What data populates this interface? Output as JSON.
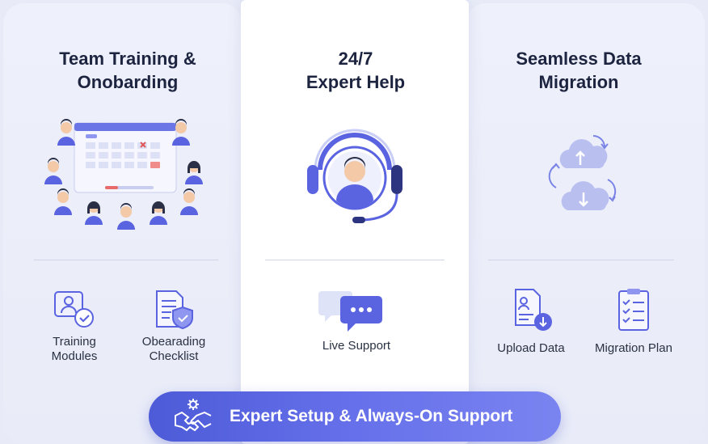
{
  "left": {
    "title_line1": "Team Training &",
    "title_line2": "Onobarding",
    "item1_line1": "Training",
    "item1_line2": "Modules",
    "item2_line1": "Obearading",
    "item2_line2": "Checklist",
    "icons": [
      "team-calendar-icon",
      "training-modules-icon",
      "onboarding-checklist-icon"
    ]
  },
  "center": {
    "title_line1": "24/7",
    "title_line2": "Expert Help",
    "item1": "Live Support",
    "icons": [
      "headset-agent-icon",
      "chat-bubble-icon"
    ]
  },
  "right": {
    "title_line1": "Seamless Data",
    "title_line2": "Migration",
    "item1": "Upload Data",
    "item2": "Migration Plan",
    "icons": [
      "cloud-sync-icon",
      "upload-document-icon",
      "migration-plan-icon"
    ]
  },
  "banner": {
    "text": "Expert Setup & Always-On Support",
    "icon": "handshake-gear-icon"
  },
  "colors": {
    "accent": "#5a63e0",
    "accent_light": "#8e96ef",
    "background": "#e8ebf7",
    "title": "#1c2440"
  }
}
